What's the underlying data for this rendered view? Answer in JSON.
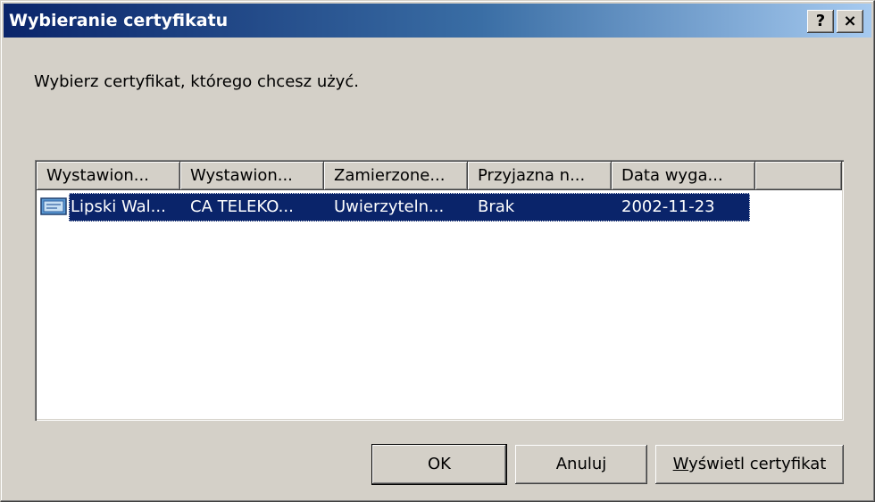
{
  "window": {
    "title": "Wybieranie certyfikatu",
    "help_label": "?",
    "close_label": "×"
  },
  "prompt": "Wybierz certyfikat, którego chcesz użyć.",
  "table": {
    "columns": [
      "Wystawion...",
      "Wystawion...",
      "Zamierzone...",
      "Przyjazna n...",
      "Data wyga..."
    ],
    "rows": [
      {
        "icon": "certificate-icon",
        "selected": true,
        "cells": [
          "Lipski Wal...",
          "CA TELEKO...",
          "Uwierzyteln...",
          "Brak",
          "2002-11-23"
        ]
      }
    ]
  },
  "buttons": {
    "ok": "OK",
    "cancel": "Anuluj",
    "view_accel": "W",
    "view_rest": "yświetl certyfikat"
  },
  "colors": {
    "selection": "#0a246a",
    "face": "#d4d0c8",
    "title_start": "#0a246a",
    "title_end": "#a6caf0"
  }
}
